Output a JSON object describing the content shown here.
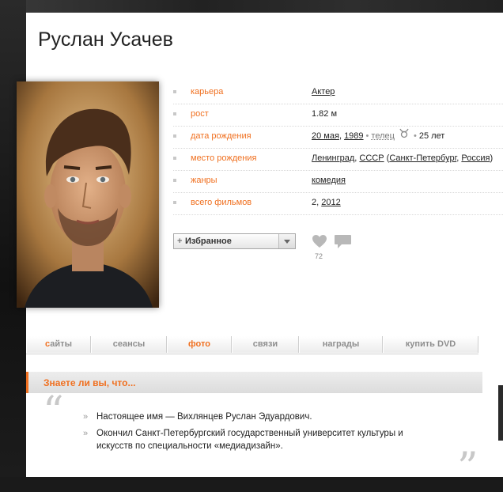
{
  "person": {
    "name": "Руслан Усачев"
  },
  "info": [
    {
      "label": "карьера",
      "value": "Актер"
    },
    {
      "label": "рост",
      "value": "1.82 м"
    },
    {
      "label": "дата рождения",
      "date": "20 мая",
      "year": "1989",
      "zodiac": "телец",
      "age": "25 лет"
    },
    {
      "label": "место рождения",
      "city": "Ленинград",
      "country": "СССР",
      "city_now": "Санкт-Петербург",
      "country_now": "Россия"
    },
    {
      "label": "жанры",
      "value": "комедия"
    },
    {
      "label": "всего фильмов",
      "count": "2,",
      "year": "2012"
    }
  ],
  "actions": {
    "favorite_label": "Избранное",
    "favorite_plus": "+",
    "likes": "72"
  },
  "tabs": [
    {
      "first": "с",
      "rest": "айты"
    },
    {
      "label": "сеансы"
    },
    {
      "label": "фото"
    },
    {
      "label": "связи"
    },
    {
      "label": "награды"
    },
    {
      "label": "купить DVD"
    }
  ],
  "did_you_know": {
    "title": "Знаете ли вы, что...",
    "open_quote": "“",
    "close_quote": "”",
    "mark": "»",
    "facts": [
      "Настоящее имя — Вихлянцев Руслан Эдуардович.",
      "Окончил Санкт-Петербургский государственный университет культуры и искусств по специальности «медиадизайн»."
    ]
  },
  "colors": {
    "accent": "#f07020",
    "label": "#f07020",
    "tab_text": "#8e8e8e"
  },
  "icons": [
    "heart-icon",
    "comment-icon",
    "taurus-zodiac-icon",
    "dropdown-arrow-icon"
  ]
}
